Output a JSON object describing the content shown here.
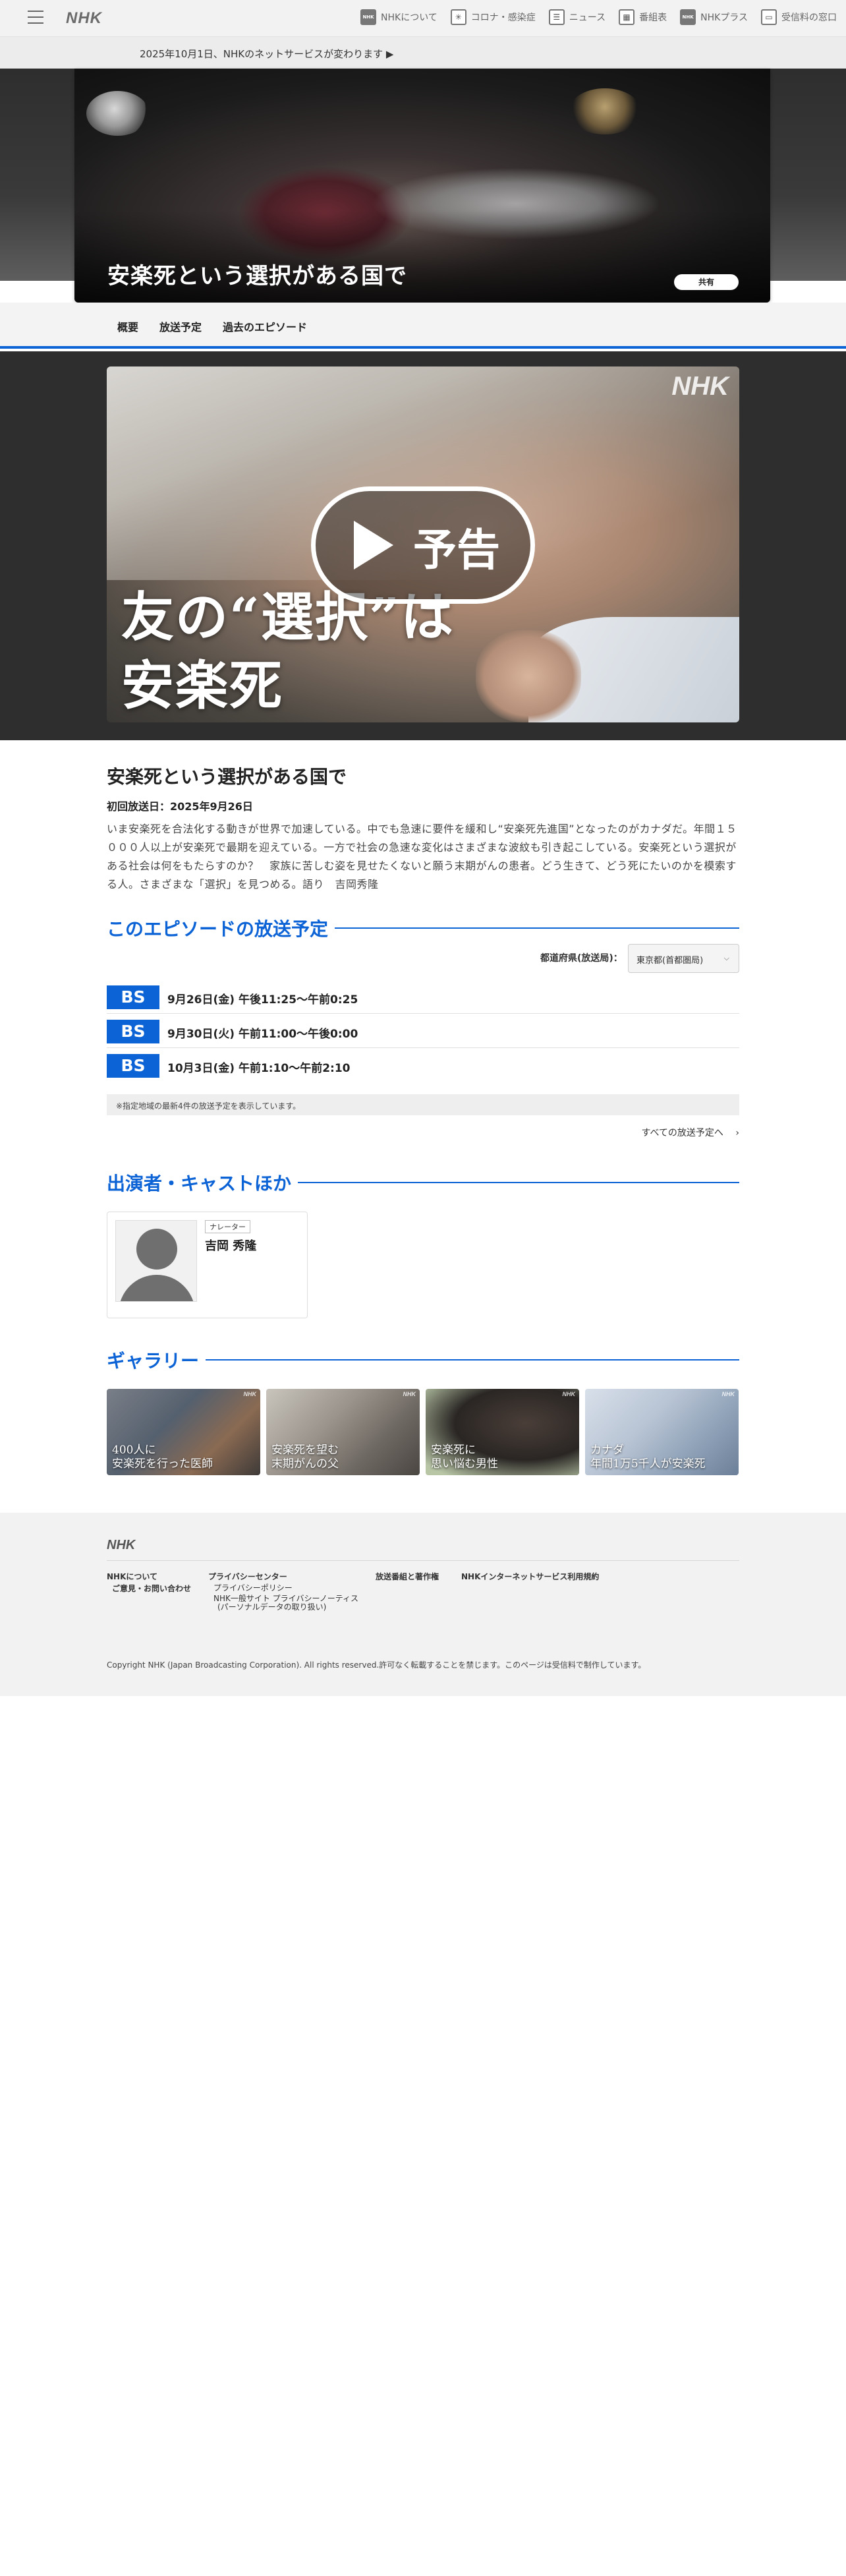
{
  "header": {
    "logo": "NHK",
    "nav": [
      {
        "label": "NHKについて",
        "icon": "nhk-logo-icon",
        "badge": "NHK"
      },
      {
        "label": "コロナ・感染症",
        "icon": "virus-icon",
        "badge": "✳"
      },
      {
        "label": "ニュース",
        "icon": "news-icon",
        "badge": "☰"
      },
      {
        "label": "番組表",
        "icon": "schedule-grid-icon",
        "badge": "▦"
      },
      {
        "label": "NHKプラス",
        "icon": "nhk-plus-icon",
        "badge": "NHK"
      },
      {
        "label": "受信料の窓口",
        "icon": "tv-fee-icon",
        "badge": "▭"
      }
    ]
  },
  "notice": {
    "text": "2025年10月1日、NHKのネットサービスが変わります ▶"
  },
  "hero": {
    "title": "安楽死という選択がある国で",
    "share_label": "共有"
  },
  "tabs": [
    {
      "label": "概要"
    },
    {
      "label": "放送予定"
    },
    {
      "label": "過去のエピソード"
    }
  ],
  "video": {
    "watermark": "NHK",
    "promo_line1": "友の“選択”は",
    "promo_line2": "安楽死",
    "play_label": "予告"
  },
  "episode": {
    "title": "安楽死という選択がある国で",
    "first_air": "初回放送日：2025年9月26日",
    "description": "いま安楽死を合法化する動きが世界で加速している。中でも急速に要件を緩和し“安楽死先進国”となったのがカナダだ。年間１５０００人以上が安楽死で最期を迎えている。一方で社会の急速な変化はさまざまな波紋も引き起こしている。安楽死という選択がある社会は何をもたらすのか？　家族に苦しむ姿を見せたくないと願う末期がんの患者。どう生きて、どう死にたいのかを模索する人。さまざまな「選択」を見つめる。語り　吉岡秀隆"
  },
  "schedule": {
    "section_title": "このエピソードの放送予定",
    "prefecture_label": "都道府県(放送局)：",
    "prefecture_value": "東京都(首都圏局)",
    "rows": [
      {
        "channel": "BS",
        "time": "9月26日(金) 午後11:25〜午前0:25"
      },
      {
        "channel": "BS",
        "time": "9月30日(火) 午前11:00〜午後0:00"
      },
      {
        "channel": "BS",
        "time": "10月3日(金) 午前1:10〜午前2:10"
      }
    ],
    "note": "※指定地域の最新4件の放送予定を表示しています。",
    "all_link": "すべての放送予定へ"
  },
  "cast": {
    "section_title": "出演者・キャストほか",
    "members": [
      {
        "role": "ナレーター",
        "name": "吉岡 秀隆"
      }
    ]
  },
  "gallery": {
    "section_title": "ギャラリー",
    "watermark": "NHK",
    "items": [
      {
        "caption_line1": "400人に",
        "caption_line2": "安楽死を行った医師"
      },
      {
        "caption_line1": "安楽死を望む",
        "caption_line2": "末期がんの父"
      },
      {
        "caption_line1": "安楽死に",
        "caption_line2": "思い悩む男性"
      },
      {
        "caption_line1": "カナダ",
        "caption_line2": "年間1万5千人が安楽死"
      }
    ]
  },
  "footer": {
    "logo": "NHK",
    "links": {
      "about": "NHKについて",
      "contact": "ご意見・お問い合わせ",
      "privacy_center": "プライバシーセンター",
      "privacy_policy": "プライバシーポリシー",
      "privacy_notice_line1": "NHK一般サイト プライバシーノーティス",
      "privacy_notice_line2": "(パーソナルデータの取り扱い)",
      "copyright_rules": "放送番組と著作権",
      "terms": "NHKインターネットサービス利用規約"
    },
    "copyright": "Copyright NHK (Japan Broadcasting Corporation). All rights reserved.許可なく転載することを禁じます。このページは受信料で制作しています。"
  }
}
